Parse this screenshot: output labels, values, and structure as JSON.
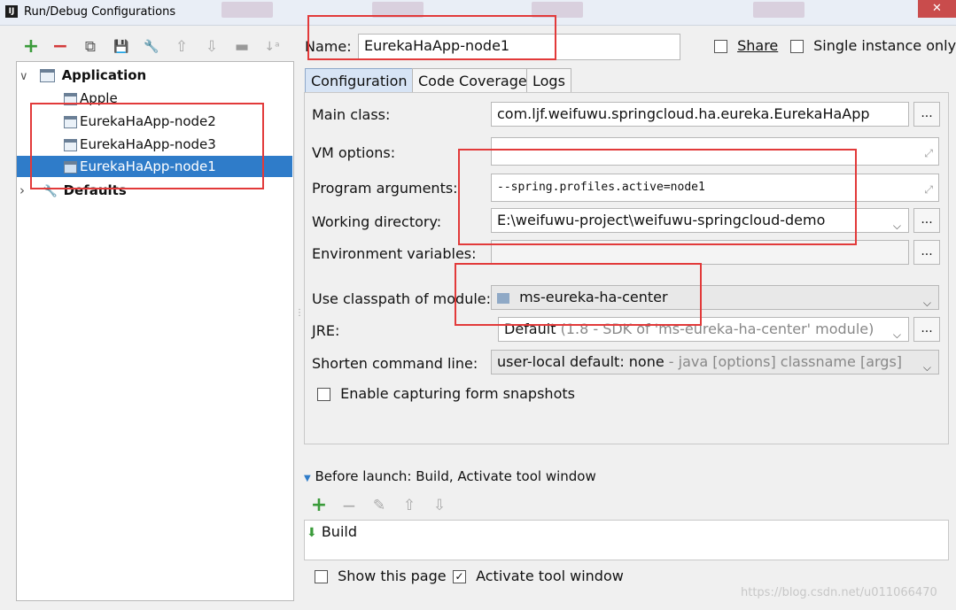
{
  "window": {
    "title": "Run/Debug Configurations",
    "app_badge": "IJ",
    "close_glyph": "✕"
  },
  "toolbar": {
    "add": "+",
    "remove": "−",
    "copy": "⧉",
    "save": "💾",
    "edit_defaults": "🔧",
    "move_up": "⇧",
    "move_down": "⇩",
    "folder": "▬",
    "sort": "↓ᵃ"
  },
  "tree": {
    "application_label": "Application",
    "items": [
      "Apple",
      "EurekaHaApp-node2",
      "EurekaHaApp-node3",
      "EurekaHaApp-node1"
    ],
    "selected_index": 3,
    "defaults_label": "Defaults",
    "expand_open": "∨",
    "expand_closed": "›"
  },
  "header": {
    "name_label": "Name:",
    "name_value": "EurekaHaApp-node1",
    "share_label": "Share",
    "single_instance_label": "Single instance only"
  },
  "tabs": [
    "Configuration",
    "Code Coverage",
    "Logs"
  ],
  "form": {
    "main_class_label": "Main class:",
    "main_class_value": "com.ljf.weifuwu.springcloud.ha.eureka.EurekaHaApp",
    "vm_options_label": "VM options:",
    "vm_options_value": "",
    "program_args_label": "Program arguments:",
    "program_args_value": "--spring.profiles.active=node1",
    "working_dir_label": "Working directory:",
    "working_dir_value": "E:\\weifuwu-project\\weifuwu-springcloud-demo",
    "env_vars_label": "Environment variables:",
    "env_vars_value": "",
    "classpath_label": "Use classpath of module:",
    "classpath_value": "ms-eureka-ha-center",
    "jre_label": "JRE:",
    "jre_value": "Default",
    "jre_hint": "(1.8 - SDK of 'ms-eureka-ha-center' module)",
    "shorten_label": "Shorten command line:",
    "shorten_value": "user-local default: none",
    "shorten_hint": "- java [options] classname [args]",
    "capture_snapshots_label": "Enable capturing form snapshots",
    "ellipsis": "...",
    "chevron": "⌵",
    "expand_glyph": "⤢"
  },
  "before_launch": {
    "title": "Before launch: Build, Activate tool window",
    "add": "+",
    "remove": "−",
    "edit": "✎",
    "up": "⇧",
    "down": "⇩",
    "task": "Build",
    "task_glyph": "⬇"
  },
  "footer": {
    "show_page_label": "Show this page",
    "show_page_checked": false,
    "activate_tool_label": "Activate tool window",
    "activate_tool_checked": true,
    "checkmark": "✓",
    "watermark": "https://blog.csdn.net/u011066470"
  },
  "colors": {
    "selection": "#2f7cc9",
    "annotation": "#e23a3a",
    "add_green": "#3a9b3a",
    "remove_red": "#d33b3b"
  }
}
